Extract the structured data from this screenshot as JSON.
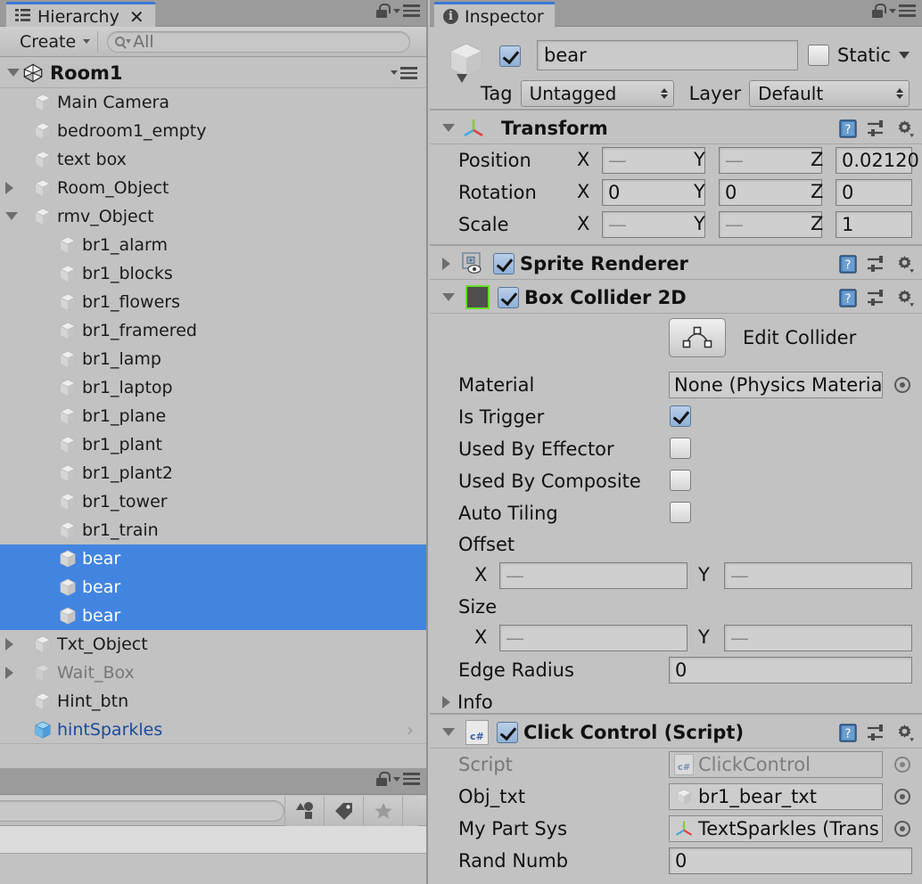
{
  "hierarchy": {
    "tab_label": "Hierarchy",
    "close_glyph": "✕",
    "toolbar": {
      "create_label": "Create",
      "search_value": "All",
      "search_placeholder": "All"
    },
    "scene_name": "Room1",
    "items": [
      {
        "label": "Main Camera",
        "depth": 1,
        "foldout": "none",
        "state": "normal",
        "icon": "cube-icon"
      },
      {
        "label": "bedroom1_empty",
        "depth": 1,
        "foldout": "none",
        "state": "normal",
        "icon": "cube-icon"
      },
      {
        "label": "text box",
        "depth": 1,
        "foldout": "none",
        "state": "normal",
        "icon": "cube-icon"
      },
      {
        "label": "Room_Object",
        "depth": 1,
        "foldout": "closed",
        "state": "normal",
        "icon": "cube-icon"
      },
      {
        "label": "rmv_Object",
        "depth": 1,
        "foldout": "open",
        "state": "normal",
        "icon": "cube-icon"
      },
      {
        "label": "br1_alarm",
        "depth": 2,
        "foldout": "none",
        "state": "normal",
        "icon": "cube-icon"
      },
      {
        "label": "br1_blocks",
        "depth": 2,
        "foldout": "none",
        "state": "normal",
        "icon": "cube-icon"
      },
      {
        "label": "br1_flowers",
        "depth": 2,
        "foldout": "none",
        "state": "normal",
        "icon": "cube-icon"
      },
      {
        "label": "br1_framered",
        "depth": 2,
        "foldout": "none",
        "state": "normal",
        "icon": "cube-icon"
      },
      {
        "label": "br1_lamp",
        "depth": 2,
        "foldout": "none",
        "state": "normal",
        "icon": "cube-icon"
      },
      {
        "label": "br1_laptop",
        "depth": 2,
        "foldout": "none",
        "state": "normal",
        "icon": "cube-icon"
      },
      {
        "label": "br1_plane",
        "depth": 2,
        "foldout": "none",
        "state": "normal",
        "icon": "cube-icon"
      },
      {
        "label": "br1_plant",
        "depth": 2,
        "foldout": "none",
        "state": "normal",
        "icon": "cube-icon"
      },
      {
        "label": "br1_plant2",
        "depth": 2,
        "foldout": "none",
        "state": "normal",
        "icon": "cube-icon"
      },
      {
        "label": "br1_tower",
        "depth": 2,
        "foldout": "none",
        "state": "normal",
        "icon": "cube-icon"
      },
      {
        "label": "br1_train",
        "depth": 2,
        "foldout": "none",
        "state": "normal",
        "icon": "cube-icon"
      },
      {
        "label": "bear",
        "depth": 2,
        "foldout": "none",
        "state": "selected",
        "icon": "cube-icon"
      },
      {
        "label": "bear",
        "depth": 2,
        "foldout": "none",
        "state": "selected",
        "icon": "cube-icon"
      },
      {
        "label": "bear",
        "depth": 2,
        "foldout": "none",
        "state": "selected",
        "icon": "cube-icon"
      },
      {
        "label": "Txt_Object",
        "depth": 1,
        "foldout": "closed",
        "state": "normal",
        "icon": "cube-icon"
      },
      {
        "label": "Wait_Box",
        "depth": 1,
        "foldout": "closed",
        "state": "disabled",
        "icon": "cube-icon"
      },
      {
        "label": "Hint_btn",
        "depth": 1,
        "foldout": "none",
        "state": "normal",
        "icon": "cube-icon"
      },
      {
        "label": "hintSparkles",
        "depth": 1,
        "foldout": "none",
        "state": "prefab",
        "icon": "prefab-cube-icon",
        "chevron": "›"
      }
    ],
    "colors": {
      "selection": "#4285e0",
      "prefab_text": "#1b4a9c",
      "disabled_text": "#777777"
    }
  },
  "project_panel": {
    "search_value": "",
    "buttons": [
      "filter-by-type-icon",
      "filter-by-label-icon",
      "favorites-star-icon"
    ]
  },
  "inspector": {
    "tab_label": "Inspector",
    "object": {
      "enabled": true,
      "name": "bear",
      "static_label": "Static",
      "static_checked": false,
      "tag_label": "Tag",
      "tag_value": "Untagged",
      "layer_label": "Layer",
      "layer_value": "Default"
    },
    "components": [
      {
        "name": "transform",
        "title": "Transform",
        "expanded": true,
        "rows": [
          {
            "label": "Position",
            "x": "—",
            "y": "—",
            "z": "0.02120"
          },
          {
            "label": "Rotation",
            "x": "0",
            "y": "0",
            "z": "0"
          },
          {
            "label": "Scale",
            "x": "—",
            "y": "—",
            "z": "1"
          }
        ],
        "axis_labels": [
          "X",
          "Y",
          "Z"
        ]
      },
      {
        "name": "sprite-renderer",
        "title": "Sprite Renderer",
        "expanded": false,
        "enabled": true
      },
      {
        "name": "box-collider-2d",
        "title": "Box Collider 2D",
        "expanded": true,
        "enabled": true,
        "edit_collider_label": "Edit Collider",
        "material_label": "Material",
        "material_value": "None (Physics Materia",
        "is_trigger_label": "Is Trigger",
        "is_trigger": true,
        "used_by_effector_label": "Used By Effector",
        "used_by_effector": false,
        "used_by_composite_label": "Used By Composite",
        "used_by_composite": false,
        "auto_tiling_label": "Auto Tiling",
        "auto_tiling": false,
        "offset_label": "Offset",
        "offset_x": "—",
        "offset_y": "—",
        "size_label": "Size",
        "size_x": "—",
        "size_y": "—",
        "edge_radius_label": "Edge Radius",
        "edge_radius": "0",
        "info_label": "Info",
        "axis_x": "X",
        "axis_y": "Y"
      },
      {
        "name": "click-control-script",
        "title": "Click Control (Script)",
        "expanded": true,
        "enabled": true,
        "script_label": "Script",
        "script_value": "ClickControl",
        "obj_txt_label": "Obj_txt",
        "obj_txt_value": "br1_bear_txt",
        "my_part_sys_label": "My Part Sys",
        "my_part_sys_value": "TextSparkles (Trans",
        "rand_numb_label": "Rand Numb",
        "rand_numb_value": "0"
      }
    ]
  }
}
